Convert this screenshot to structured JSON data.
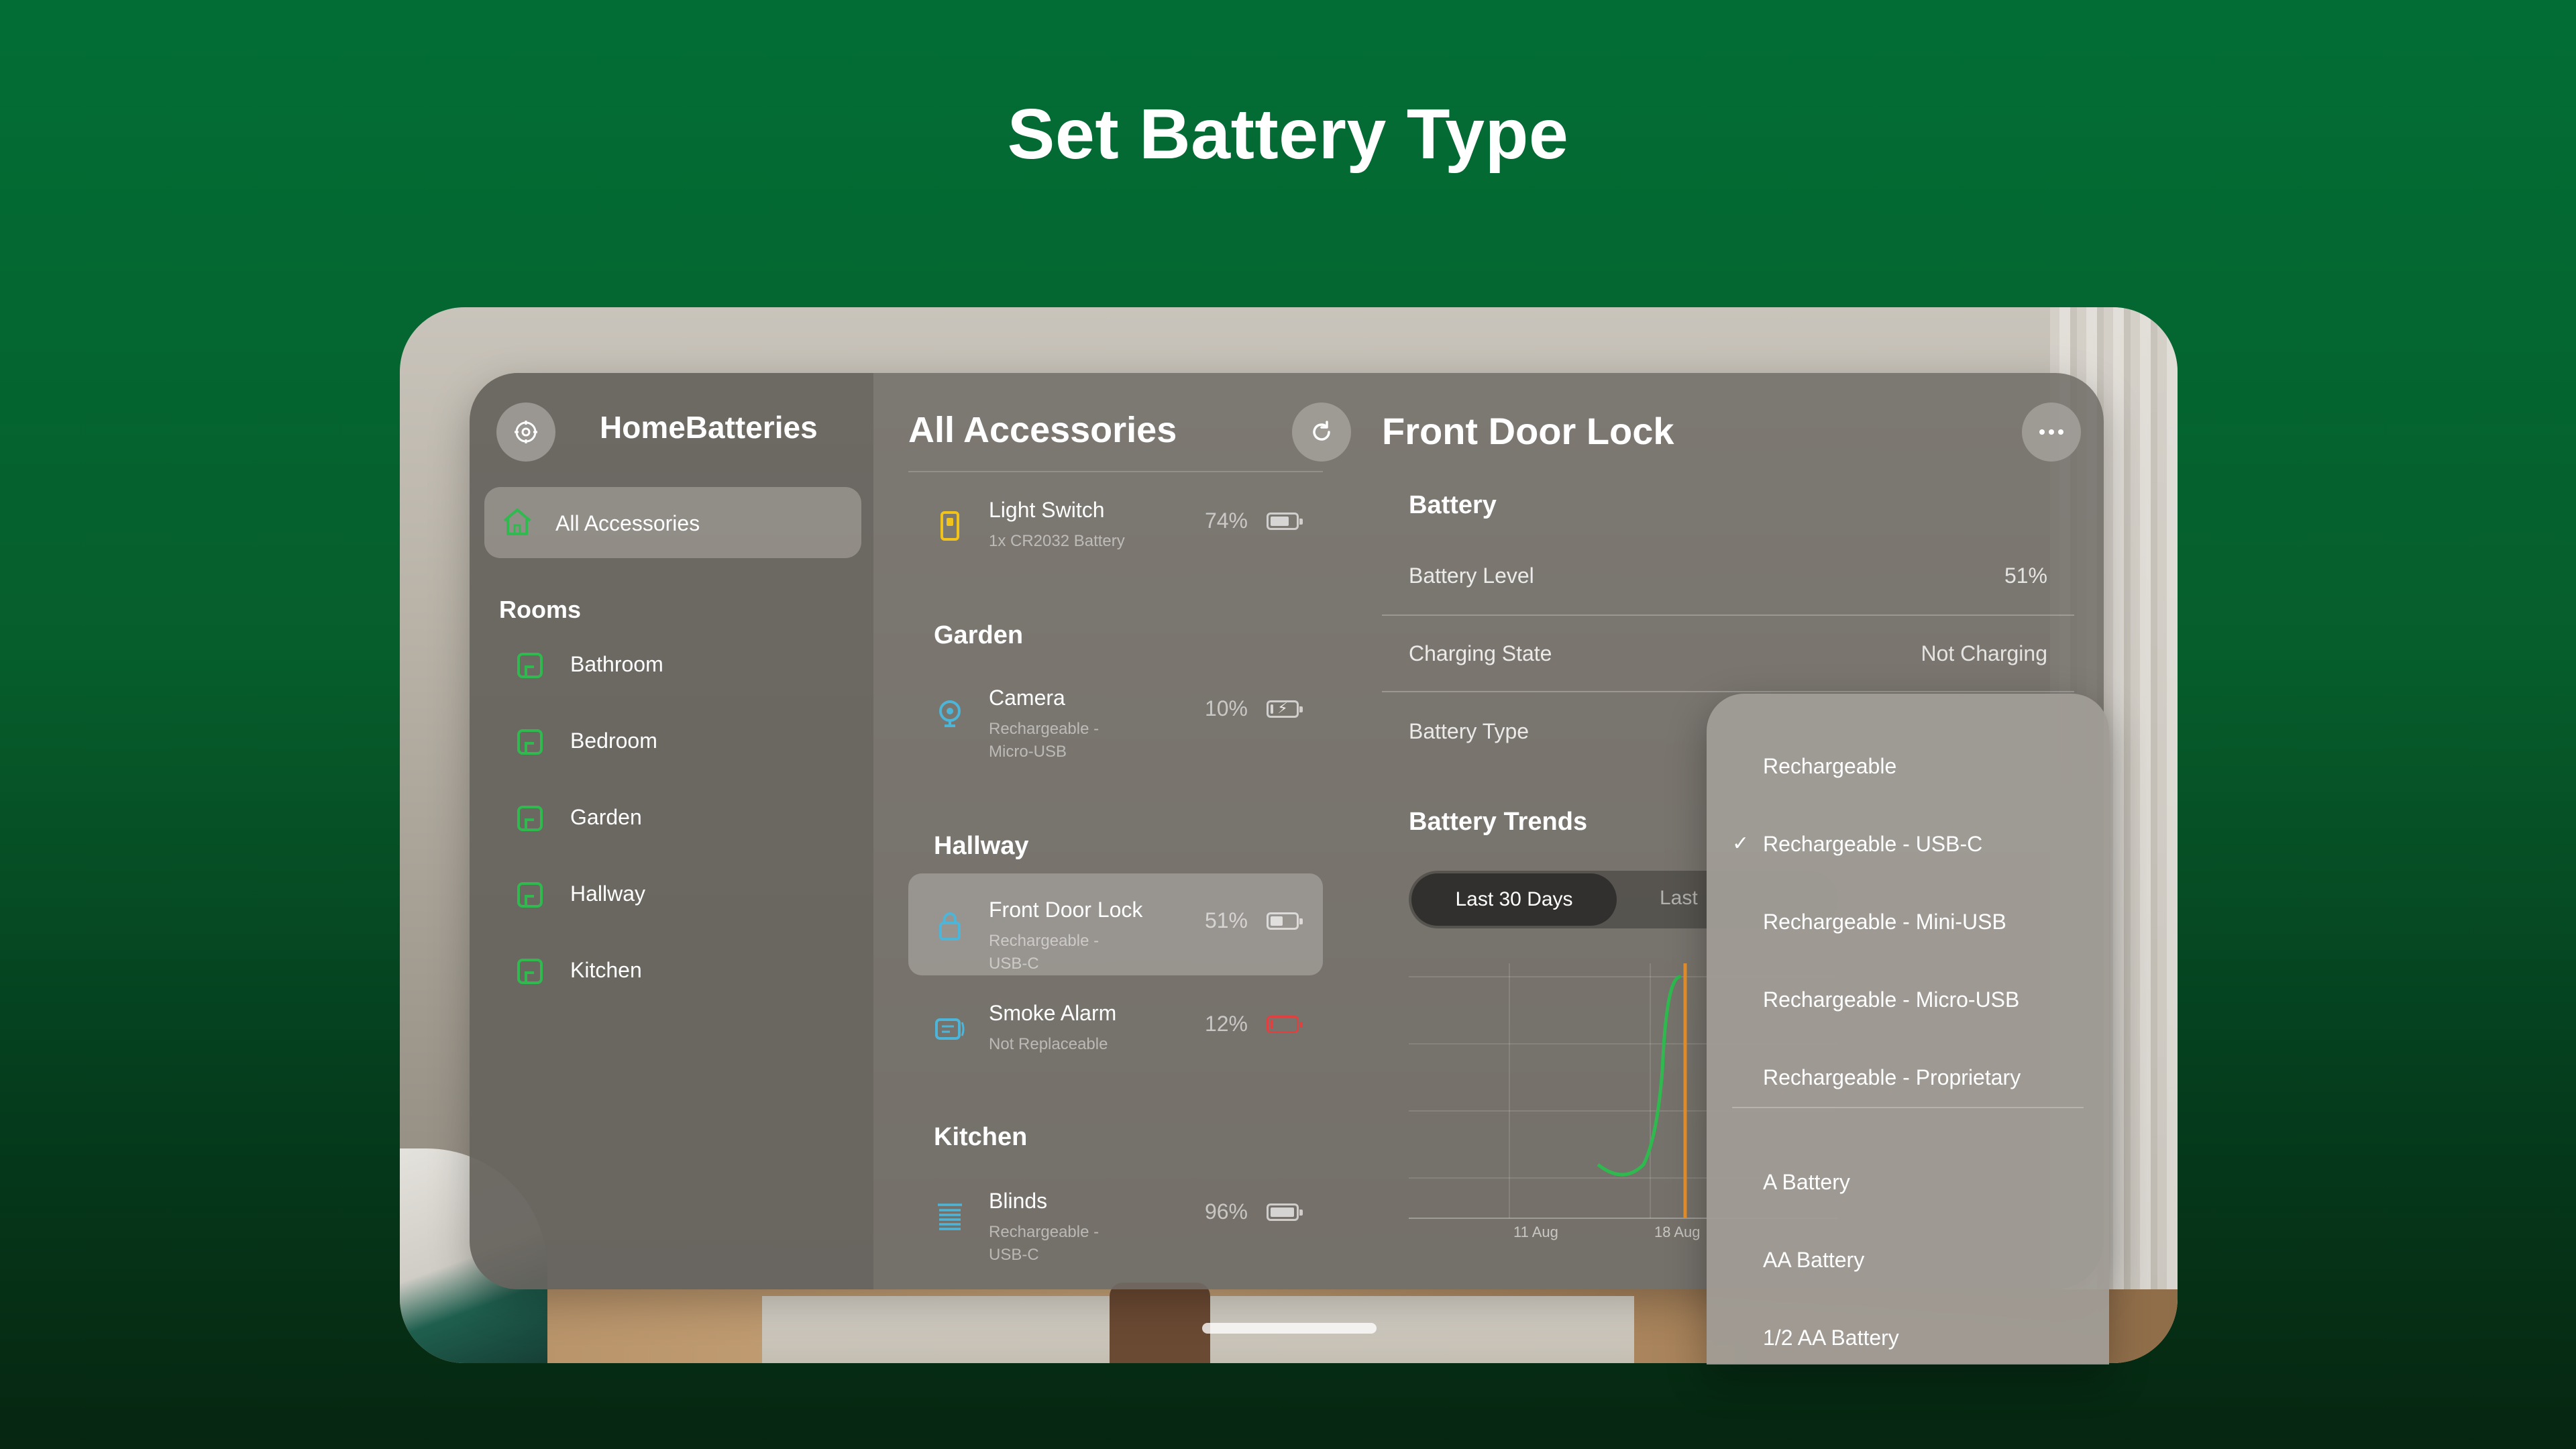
{
  "headline": "Set Battery Type",
  "app": {
    "title": "HomeBatteries",
    "colors": {
      "accent_green": "#2fb94f",
      "low_battery": "#e04040",
      "background_green": "#026e35"
    }
  },
  "sidebar": {
    "all_label": "All Accessories",
    "rooms_header": "Rooms",
    "rooms": [
      {
        "label": "Bathroom"
      },
      {
        "label": "Bedroom"
      },
      {
        "label": "Garden"
      },
      {
        "label": "Hallway"
      },
      {
        "label": "Kitchen"
      }
    ]
  },
  "list": {
    "title": "All Accessories",
    "refresh_icon": "refresh-icon",
    "top": {
      "name": "Light Switch",
      "sub": "1x CR2032 Battery",
      "pct": "74%",
      "level": 0.74,
      "icon": "light-switch-icon"
    },
    "sections": [
      {
        "header": "Garden",
        "items": [
          {
            "name": "Camera",
            "sub": "Rechargeable - Micro-USB",
            "pct": "10%",
            "level": 0.1,
            "charging": true,
            "icon": "camera-icon"
          }
        ]
      },
      {
        "header": "Hallway",
        "items": [
          {
            "name": "Front Door Lock",
            "sub": "Rechargeable - USB-C",
            "pct": "51%",
            "level": 0.51,
            "selected": true,
            "icon": "lock-icon"
          },
          {
            "name": "Smoke Alarm",
            "sub": "Not Replaceable",
            "pct": "12%",
            "level": 0.12,
            "low": true,
            "icon": "smoke-alarm-icon"
          }
        ]
      },
      {
        "header": "Kitchen",
        "items": [
          {
            "name": "Blinds",
            "sub": "Rechargeable - USB-C",
            "pct": "96%",
            "level": 0.96,
            "icon": "blinds-icon"
          }
        ]
      }
    ]
  },
  "detail": {
    "title": "Front Door Lock",
    "more_icon": "ellipsis-icon",
    "battery_header": "Battery",
    "rows": [
      {
        "label": "Battery Level",
        "value": "51%"
      },
      {
        "label": "Charging State",
        "value": "Not Charging"
      },
      {
        "label": "Battery Type",
        "value": ""
      }
    ],
    "trends_header": "Battery Trends",
    "segments": {
      "active": "Last 30 Days",
      "inactive": "Last"
    },
    "chart_ticks": [
      "11 Aug",
      "18 Aug"
    ]
  },
  "menu": {
    "selected": "Rechargeable - USB-C",
    "group1": [
      "Rechargeable",
      "Rechargeable - USB-C",
      "Rechargeable - Mini-USB",
      "Rechargeable - Micro-USB",
      "Rechargeable - Proprietary"
    ],
    "group2": [
      "A Battery",
      "AA Battery",
      "1/2 AA Battery"
    ]
  }
}
